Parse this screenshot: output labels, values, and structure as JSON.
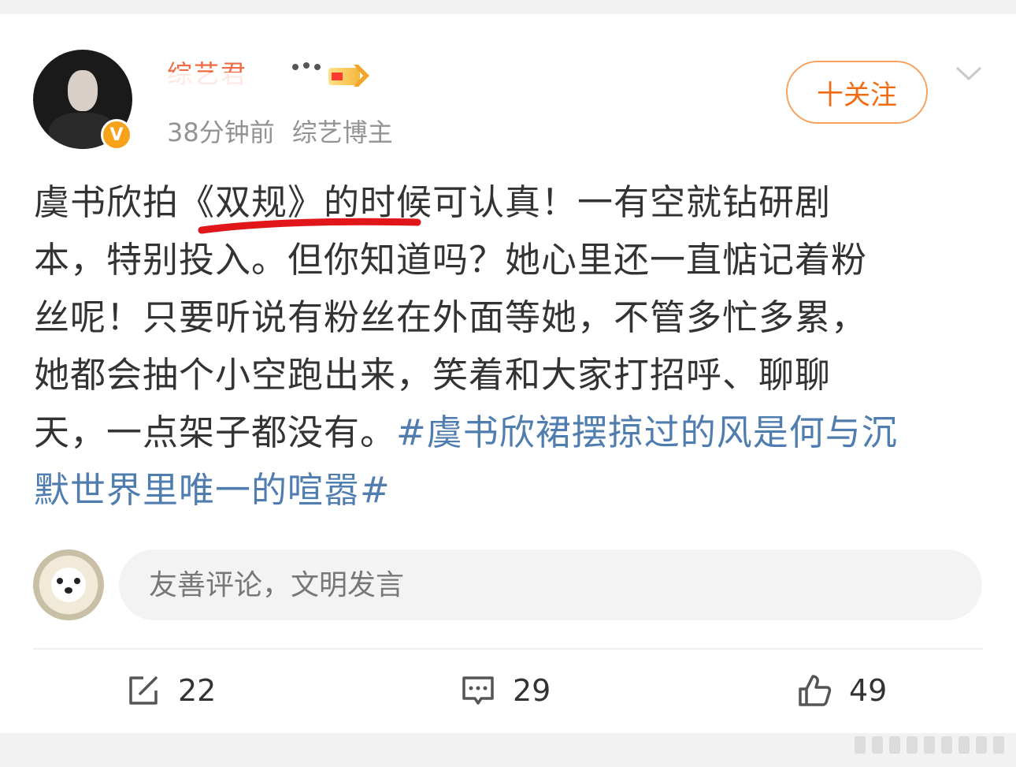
{
  "post": {
    "author": {
      "name": "综艺君",
      "time": "38分钟前",
      "role": "综艺博主",
      "verified_badge": "V",
      "member_icon": "vip-crown-icon"
    },
    "follow_label": "十关注",
    "more_icon": "chevron-down-icon",
    "text_lines": [
      "虞书欣拍《双规》的时候可认真！一有空就钻研剧",
      "本，特别投入。但你知道吗？她心里还一直惦记着粉",
      "丝呢！只要听说有粉丝在外面等她，不管多忙多累，",
      "她都会抽个小空跑出来，笑着和大家打招呼、聊聊"
    ],
    "text_line5_plain": "天，一点架子都没有。",
    "topic_part1": "#虞书欣裙摆掠过的风是何与沉",
    "topic_part2": "默世界里唯一的喧嚣#",
    "colors": {
      "topic": "#507daf",
      "follow": "#f26b11",
      "underline": "#e0161b",
      "badge": "#f7a21b"
    }
  },
  "comment": {
    "placeholder": "友善评论，文明发言"
  },
  "actions": {
    "share_count": "22",
    "comment_count": "29",
    "like_count": "49",
    "share_icon": "share-icon",
    "comment_icon": "comment-icon",
    "like_icon": "thumbs-up-icon"
  }
}
